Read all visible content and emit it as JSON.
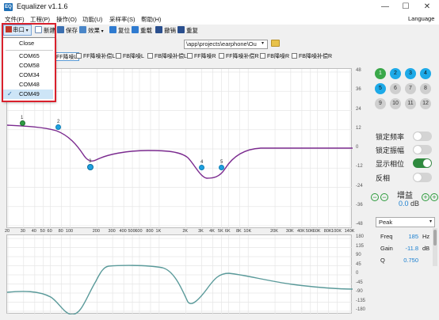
{
  "window": {
    "title": "Equalizer v1.1.6",
    "icon_text": "EQ",
    "language": "Language"
  },
  "menu": [
    "文件(F)",
    "工程(P)",
    "操作(O)",
    "功能(U)",
    "采样率(S)",
    "帮助(H)"
  ],
  "toolbar": {
    "port": "串口",
    "new": "新建",
    "save": "保存",
    "effect": "效果",
    "reset": "复位",
    "resend": "重载",
    "undo": "撤销",
    "redo": "重复"
  },
  "path": {
    "value": "\\app\\projects\\earphone\\Ou"
  },
  "tabs": [
    "FF降噪L",
    "FF降噪补偿L",
    "FB降噪L",
    "FB降噪补偿L",
    "FF降噪R",
    "FF降噪补偿R",
    "FB降噪R",
    "FB降噪补偿R"
  ],
  "dropdown": {
    "items": [
      "Close",
      "COM65",
      "COM58",
      "COM34",
      "COM48",
      "COM49"
    ],
    "checked": "COM49"
  },
  "chart": {
    "y_right_ticks": [
      "48",
      "36",
      "24",
      "12",
      "0",
      "-12",
      "-24",
      "-36",
      "-48"
    ],
    "x_ticks": [
      "20",
      "30",
      "40",
      "50",
      "60",
      "80",
      "100",
      "200",
      "300",
      "400",
      "500",
      "600",
      "800",
      "1K",
      "2K",
      "3K",
      "4K",
      "5K",
      "6K",
      "8K",
      "10K",
      "20K",
      "30K",
      "40K",
      "50K",
      "60K",
      "80K",
      "100K",
      "140K"
    ],
    "phase_ticks": [
      "180",
      "135",
      "90",
      "45",
      "0",
      "-45",
      "-90",
      "-135",
      "-180"
    ],
    "nodes": [
      {
        "label": "1",
        "color": "green"
      },
      {
        "label": "2",
        "color": "blue"
      },
      {
        "label": "3",
        "color": "blue"
      },
      {
        "label": "4",
        "color": "blue"
      },
      {
        "label": "5",
        "color": "blue"
      }
    ],
    "curve_color": "#7b2b8f",
    "phase_color": "#5a9a9a"
  },
  "bands": [
    {
      "label": "1",
      "style": "green"
    },
    {
      "label": "2",
      "style": "blue"
    },
    {
      "label": "3",
      "style": "blue"
    },
    {
      "label": "4",
      "style": "blue"
    },
    {
      "label": "5",
      "style": "blue"
    },
    {
      "label": "6",
      "style": "gray"
    },
    {
      "label": "7",
      "style": "gray"
    },
    {
      "label": "8",
      "style": "gray"
    },
    {
      "label": "9",
      "style": "gray"
    },
    {
      "label": "10",
      "style": "gray"
    },
    {
      "label": "11",
      "style": "gray"
    },
    {
      "label": "12",
      "style": "gray"
    }
  ],
  "toggles": [
    {
      "label": "锁定频率",
      "on": false
    },
    {
      "label": "锁定振幅",
      "on": false
    },
    {
      "label": "显示相位",
      "on": true
    },
    {
      "label": "反相",
      "on": false
    }
  ],
  "gain": {
    "label": "增益",
    "value": "0.0",
    "unit": "dB"
  },
  "filter": {
    "type": "Peak",
    "freq_label": "Freq",
    "freq_value": "185",
    "freq_unit": "Hz",
    "gain_label": "Gain",
    "gain_value": "-11.8",
    "gain_unit": "dB",
    "q_label": "Q",
    "q_value": "0.750"
  }
}
